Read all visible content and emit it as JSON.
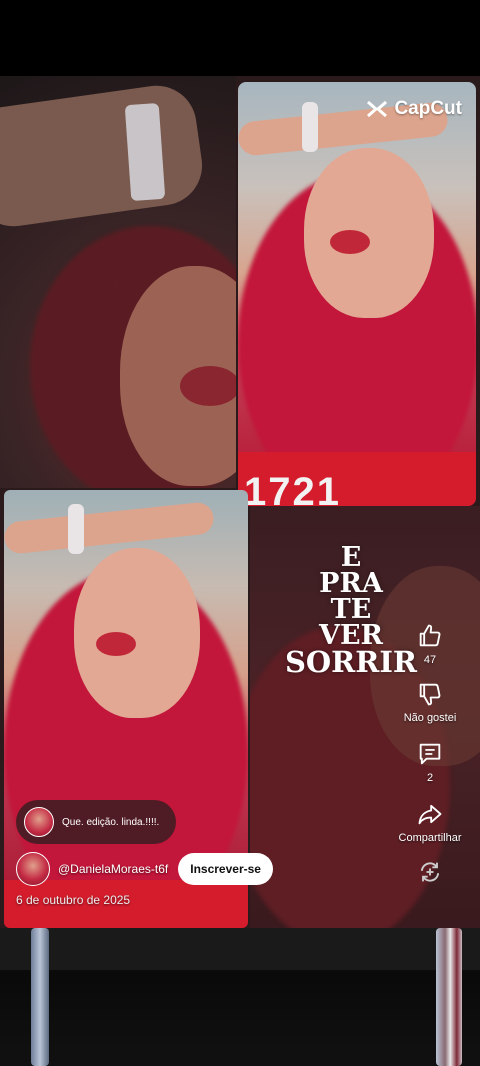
{
  "watermark": {
    "brand": "CapCut",
    "icon": "capcut-logo-icon"
  },
  "overlay_text": [
    "E",
    "PRA",
    "TE",
    "VER",
    "SORRIR"
  ],
  "shirt_text": "1721",
  "actions": {
    "like": {
      "icon": "thumbs-up-icon",
      "count": "47"
    },
    "dislike": {
      "icon": "thumbs-down-icon",
      "label": "Não gostei"
    },
    "comments": {
      "icon": "comment-icon",
      "count": "2"
    },
    "share": {
      "icon": "share-icon",
      "label": "Compartilhar"
    },
    "remix": {
      "icon": "remix-icon"
    }
  },
  "comment_preview": {
    "text": "Que.  edição.  linda.!!!!."
  },
  "channel": {
    "name": "@DanielaMoraes-t6f",
    "subscribe_label": "Inscrever-se"
  },
  "date": "6 de outubro de 2025",
  "colors": {
    "accent_red": "#d41c2c",
    "subscribe_bg": "#ffffff"
  }
}
